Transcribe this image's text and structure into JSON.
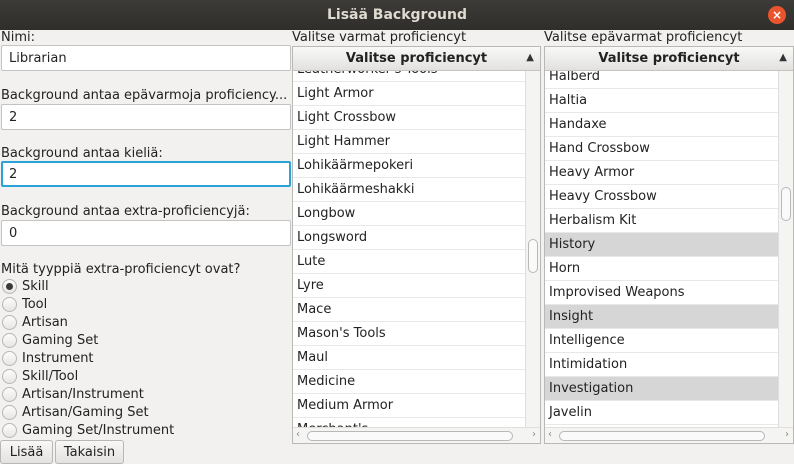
{
  "window": {
    "title": "Lisää Background"
  },
  "form": {
    "name_label": "Nimi:",
    "name_value": "Librarian",
    "uncertain_label": "Background antaa epävarmoja proficiency...",
    "uncertain_value": "2",
    "languages_label": "Background antaa kieliä:",
    "languages_value": "2",
    "extra_label": "Background antaa extra-proficiencyjä:",
    "extra_value": "0",
    "type_question": "Mitä tyyppiä extra-proficiencyt ovat?",
    "radio_options": [
      {
        "label": "Skill",
        "checked": true
      },
      {
        "label": "Tool",
        "checked": false
      },
      {
        "label": "Artisan",
        "checked": false
      },
      {
        "label": "Gaming Set",
        "checked": false
      },
      {
        "label": "Instrument",
        "checked": false
      },
      {
        "label": "Skill/Tool",
        "checked": false
      },
      {
        "label": "Artisan/Instrument",
        "checked": false
      },
      {
        "label": "Artisan/Gaming Set",
        "checked": false
      },
      {
        "label": "Gaming Set/Instrument",
        "checked": false
      }
    ],
    "add_button": "Lisää",
    "back_button": "Takaisin"
  },
  "certain_list": {
    "caption": "Valitse varmat proficiencyt",
    "header": "Valitse proficiencyt",
    "items": [
      {
        "label": "Leatherworker's Tools",
        "selected": false
      },
      {
        "label": "Light Armor",
        "selected": false
      },
      {
        "label": "Light Crossbow",
        "selected": false
      },
      {
        "label": "Light Hammer",
        "selected": false
      },
      {
        "label": "Lohikäärmepokeri",
        "selected": false
      },
      {
        "label": "Lohikäärmeshakki",
        "selected": false
      },
      {
        "label": "Longbow",
        "selected": false
      },
      {
        "label": "Longsword",
        "selected": false
      },
      {
        "label": "Lute",
        "selected": false
      },
      {
        "label": "Lyre",
        "selected": false
      },
      {
        "label": "Mace",
        "selected": false
      },
      {
        "label": "Mason's Tools",
        "selected": false
      },
      {
        "label": "Maul",
        "selected": false
      },
      {
        "label": "Medicine",
        "selected": false
      },
      {
        "label": "Medium Armor",
        "selected": false
      },
      {
        "label": "Merchant's...",
        "selected": false
      }
    ]
  },
  "uncertain_list": {
    "caption": "Valitse epävarmat proficiencyt",
    "header": "Valitse proficiencyt",
    "items": [
      {
        "label": "Halberd",
        "selected": false
      },
      {
        "label": "Haltia",
        "selected": false
      },
      {
        "label": "Handaxe",
        "selected": false
      },
      {
        "label": "Hand Crossbow",
        "selected": false
      },
      {
        "label": "Heavy Armor",
        "selected": false
      },
      {
        "label": "Heavy Crossbow",
        "selected": false
      },
      {
        "label": "Herbalism Kit",
        "selected": false
      },
      {
        "label": "History",
        "selected": true
      },
      {
        "label": "Horn",
        "selected": false
      },
      {
        "label": "Improvised Weapons",
        "selected": false
      },
      {
        "label": "Insight",
        "selected": true
      },
      {
        "label": "Intelligence",
        "selected": false
      },
      {
        "label": "Intimidation",
        "selected": false
      },
      {
        "label": "Investigation",
        "selected": true
      },
      {
        "label": "Javelin",
        "selected": false
      }
    ]
  },
  "colors": {
    "focus": "#2aa3d8",
    "selected_row": "#d6d6d6",
    "titlebar": "#3c3b37",
    "close": "#e9542e"
  },
  "icons": {
    "close": "close-icon",
    "sort": "sort-ascending-icon",
    "scroll_left": "chevron-left-icon",
    "scroll_right": "chevron-right-icon"
  }
}
